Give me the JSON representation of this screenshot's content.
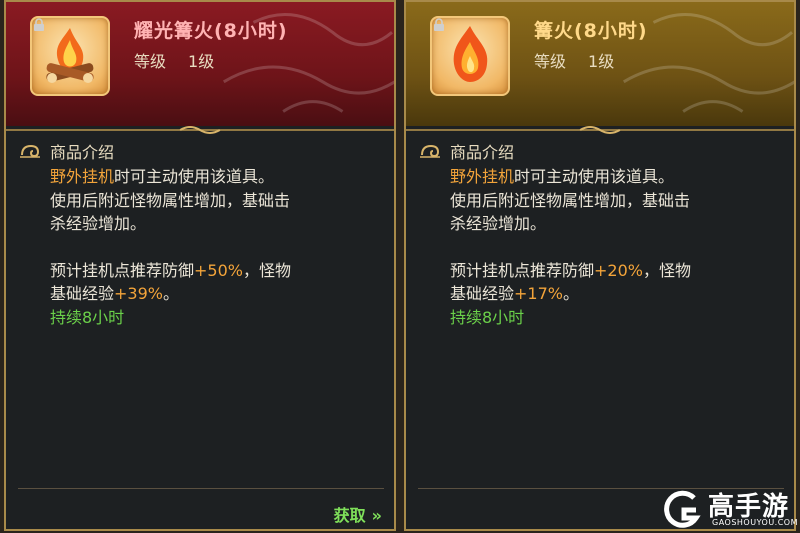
{
  "left_item": {
    "title": "耀光篝火(8小时)",
    "level_label": "等级",
    "level_value": "1级",
    "section_title": "商品介绍",
    "desc_line1_hl": "野外挂机",
    "desc_line1_rest": "时可主动使用该道具。",
    "desc_line2": "使用后附近怪物属性增加，基础击",
    "desc_line3": "杀经验增加。",
    "desc_line4_pre": "预计挂机点推荐防御",
    "desc_line4_value": "+50%",
    "desc_line4_post": "，怪物",
    "desc_line5_pre": "基础经验",
    "desc_line5_value": "+39%",
    "desc_line5_post": "。",
    "duration": "持续8小时",
    "acquire_label": "获取",
    "acquire_chevron": "»",
    "icon": "bonfire-icon"
  },
  "right_item": {
    "title": "篝火(8小时)",
    "level_label": "等级",
    "level_value": "1级",
    "section_title": "商品介绍",
    "desc_line1_hl": "野外挂机",
    "desc_line1_rest": "时可主动使用该道具。",
    "desc_line2": "使用后附近怪物属性增加，基础击",
    "desc_line3": "杀经验增加。",
    "desc_line4_pre": "预计挂机点推荐防御",
    "desc_line4_value": "+20%",
    "desc_line4_post": "，怪物",
    "desc_line5_pre": "基础经验",
    "desc_line5_value": "+17%",
    "desc_line5_post": "。",
    "duration": "持续8小时",
    "icon": "fire-icon"
  },
  "watermark": {
    "brand": "高手游",
    "url": "GAOSHOUYOU.COM"
  },
  "colors": {
    "left_header": "#8a1a22",
    "right_header": "#8a6a1a",
    "highlight_orange": "#f3a43a",
    "highlight_green": "#6bd14a",
    "border_gold": "#a88a4a"
  }
}
